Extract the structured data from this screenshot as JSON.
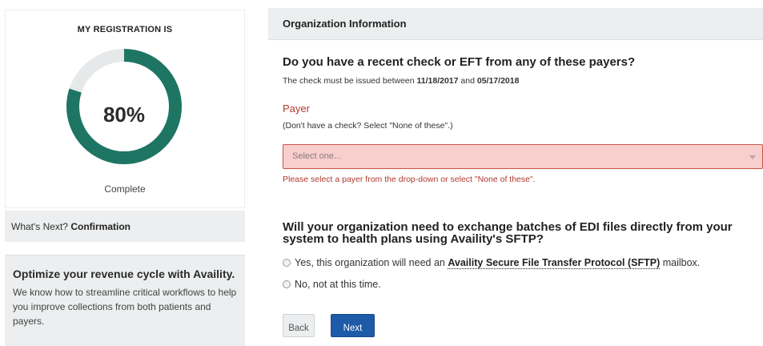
{
  "registration": {
    "title": "MY REGISTRATION IS",
    "percent_label": "80%",
    "percent_value": 80,
    "status": "Complete",
    "colors": {
      "progress": "#1e7563",
      "track": "#e6e9ea"
    }
  },
  "whats_next": {
    "prefix": "What's Next?",
    "step": "Confirmation"
  },
  "promo": {
    "title": "Optimize your revenue cycle with Availity.",
    "text": "We know how to streamline critical workflows to help you improve collections from both patients and payers."
  },
  "org": {
    "header": "Organization Information",
    "question1": "Do you have a recent check or EFT from any of these payers?",
    "check_note_prefix": "The check must be issued between",
    "check_date_start": "11/18/2017",
    "check_note_and": "and",
    "check_date_end": "05/17/2018",
    "payer_label": "Payer",
    "payer_hint": "(Don't have a check? Select \"None of these\".)",
    "payer_placeholder": "Select one...",
    "payer_error": "Please select a payer from the drop-down or select \"None of these\".",
    "question2": "Will your organization need to exchange batches of EDI files directly from your system to health plans using Availity's SFTP?",
    "option_yes_prefix": "Yes, this organization will need an",
    "option_yes_link": "Availity Secure File Transfer Protocol (SFTP)",
    "option_yes_suffix": "mailbox.",
    "option_no": "No, not at this time."
  },
  "buttons": {
    "back": "Back",
    "next": "Next"
  },
  "colors": {
    "accent": "#1d5ba8",
    "error": "#b03a2e",
    "error_bg": "#f8cfcd"
  }
}
